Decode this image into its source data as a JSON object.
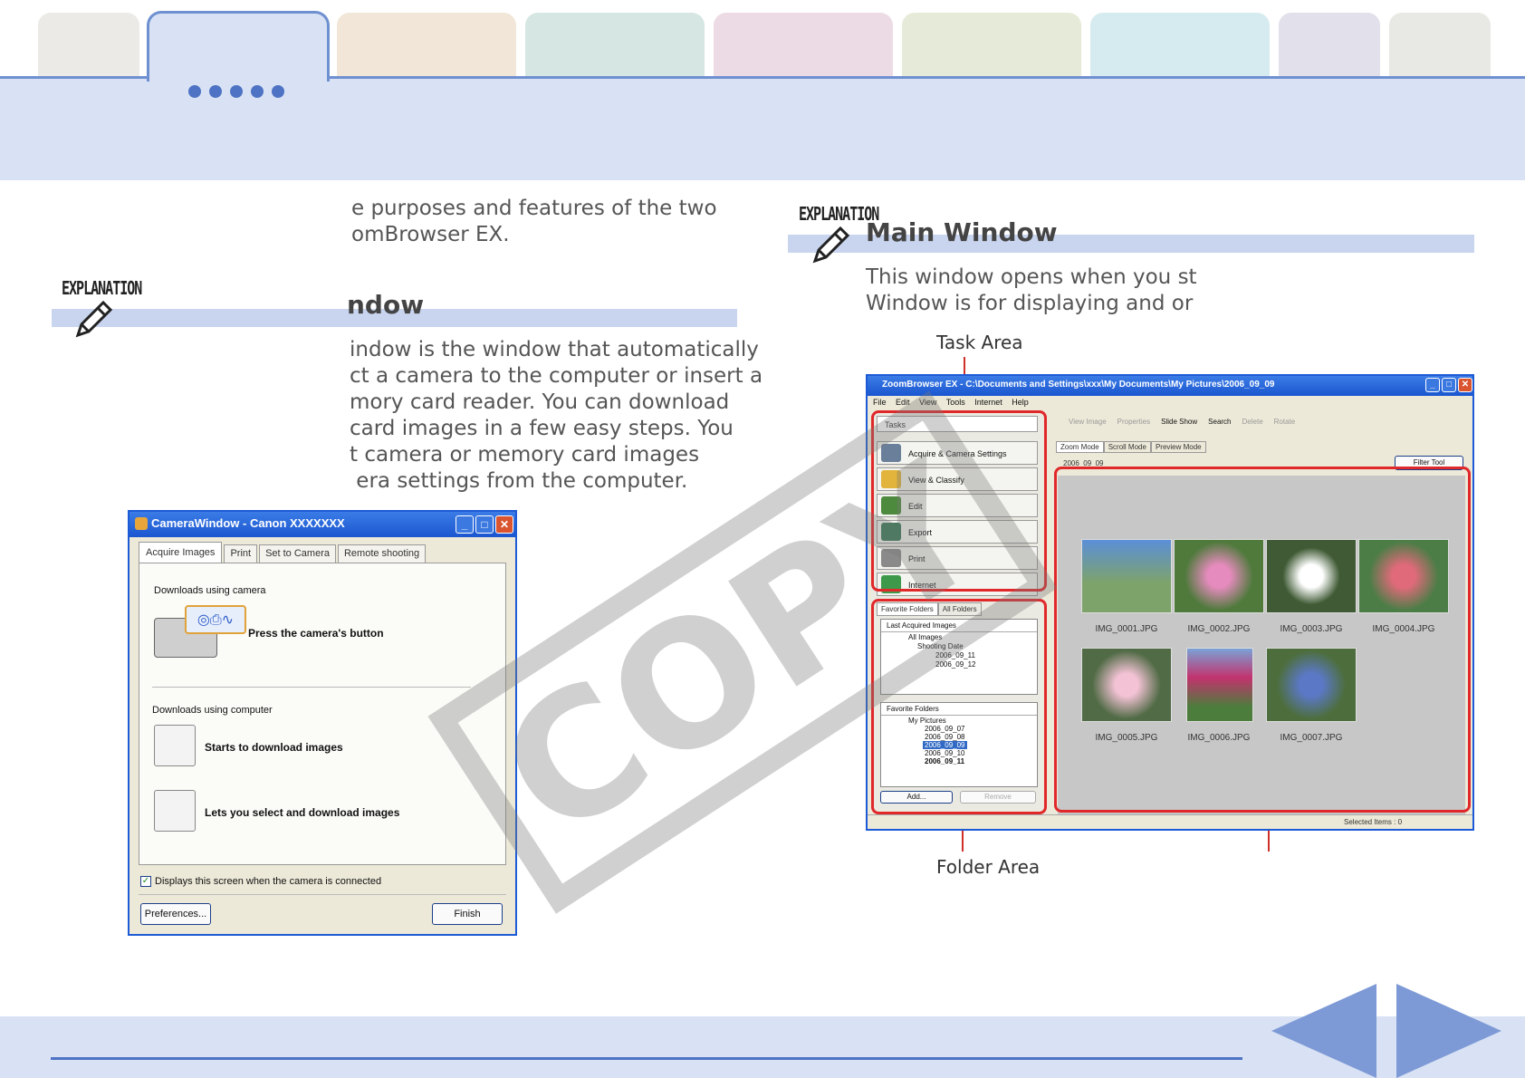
{
  "top_tabs": [
    {
      "color": "#ebeae6"
    },
    {
      "color": "#f1e6d7"
    },
    {
      "color": "#d6e6e2"
    },
    {
      "color": "#ecdbe5"
    },
    {
      "color": "#e6ebd9"
    },
    {
      "color": "#d6ebef"
    },
    {
      "color": "#e2e0ea"
    },
    {
      "color": "#e8e8e4"
    }
  ],
  "left": {
    "intro": "e purposes and features of the two\nomBrowser EX.",
    "explanation_label": "EXPLANATION",
    "heading": "ndow",
    "body": "indow is the window that automatically\nct a camera to the computer or insert a\nmory card reader. You can download\ncard images in a few easy steps. You\nt camera or memory card images\n era settings from the computer."
  },
  "right": {
    "explanation_label": "EXPLANATION",
    "heading": "Main Window",
    "body": "This window opens when you st\nWindow is for displaying and or",
    "callout_task": "Task Area",
    "callout_folder": "Folder Area"
  },
  "camera_window": {
    "title": "CameraWindow - Canon XXXXXXX",
    "tabs": [
      "Acquire Images",
      "Print",
      "Set to Camera",
      "Remote shooting"
    ],
    "section1": "Downloads using camera",
    "press_button": "Press the camera's button",
    "section2": "Downloads using computer",
    "option1": "Starts to download images",
    "option2": "Lets you select and download images",
    "checkbox": "Displays this screen when the camera is connected",
    "preferences": "Preferences...",
    "finish": "Finish"
  },
  "zoombrowser": {
    "title": "ZoomBrowser EX - C:\\Documents and Settings\\xxx\\My Documents\\My Pictures\\2006_09_09",
    "menu": "File Edit View Tools Internet Help",
    "tasks_label": "Tasks",
    "tasks": [
      "Acquire & Camera Settings",
      "View & Classify",
      "Edit",
      "Export",
      "Print",
      "Internet"
    ],
    "toolbar": [
      "View Image",
      "Properties",
      "Slide Show",
      "Search",
      "Delete",
      "Rotate"
    ],
    "modes": [
      "Zoom Mode",
      "Scroll Mode",
      "Preview Mode"
    ],
    "date": "2006_09_09",
    "filter": "Filter Tool",
    "folder_tabs": [
      "Favorite Folders",
      "All Folders"
    ],
    "last_acquired": "Last Acquired Images",
    "tree1": [
      "All Images",
      "Shooting Date",
      "2006_09_11",
      "2006_09_12"
    ],
    "favorite_folders": "Favorite Folders",
    "tree2": [
      "My Pictures",
      "2006_09_07",
      "2006_09_08",
      "2006_09_09",
      "2006_09_10",
      "2006_09_11"
    ],
    "add": "Add...",
    "remove": "Remove",
    "status": "Selected Items : 0",
    "thumbnails": [
      {
        "name": "IMG_0001.JPG",
        "color": "#7ea36a"
      },
      {
        "name": "IMG_0002.JPG",
        "color": "#c2659a"
      },
      {
        "name": "IMG_0003.JPG",
        "color": "#3f5a34"
      },
      {
        "name": "IMG_0004.JPG",
        "color": "#4d7d47"
      },
      {
        "name": "IMG_0005.JPG",
        "color": "#506b45"
      },
      {
        "name": "IMG_0006.JPG",
        "color": "#c2336e"
      },
      {
        "name": "IMG_0007.JPG",
        "color": "#4a6a9a"
      }
    ]
  },
  "watermark": "COPY"
}
